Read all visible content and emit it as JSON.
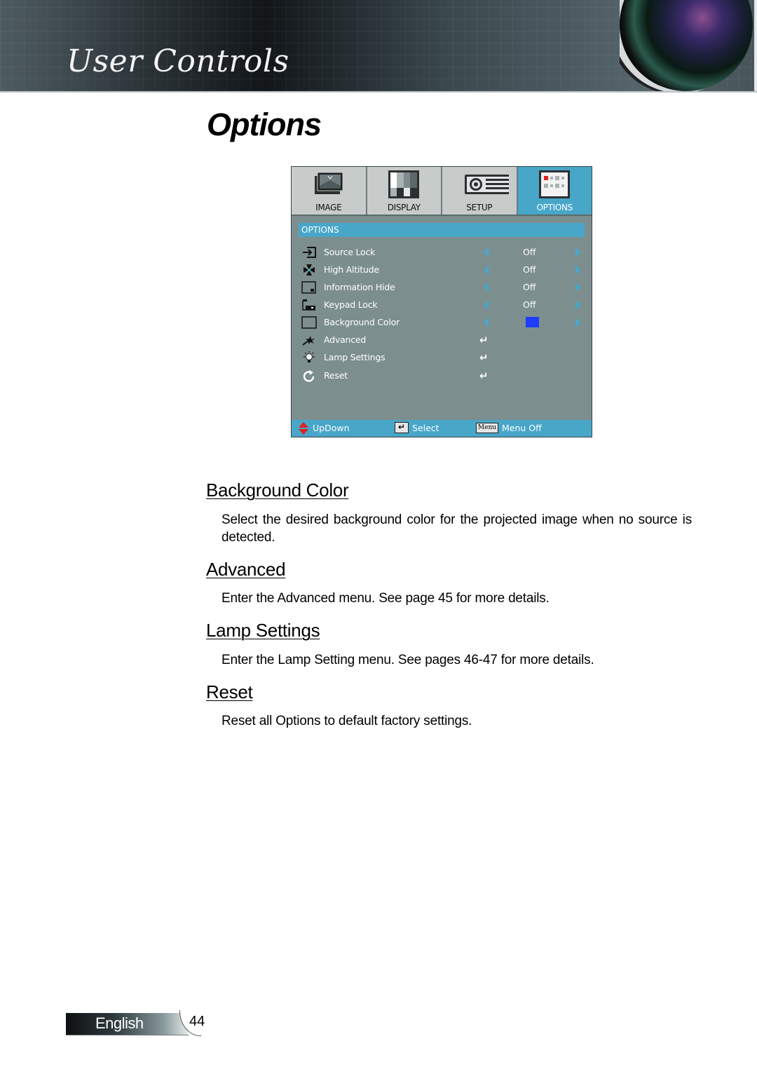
{
  "header": {
    "section_title": "User Controls",
    "page_title": "Options"
  },
  "osd": {
    "tabs": [
      {
        "label": "IMAGE",
        "icon": "image-icon",
        "active": false
      },
      {
        "label": "DISPLAY",
        "icon": "display-icon",
        "active": false
      },
      {
        "label": "SETUP",
        "icon": "projector-icon",
        "active": false
      },
      {
        "label": "OPTIONS",
        "icon": "options-icon",
        "active": true
      }
    ],
    "section_label": "OPTIONS",
    "rows": [
      {
        "label": "Source Lock",
        "icon": "source-lock-icon",
        "type": "toggle",
        "value": "Off"
      },
      {
        "label": "High Altitude",
        "icon": "fan-icon",
        "type": "toggle",
        "value": "Off"
      },
      {
        "label": "Information Hide",
        "icon": "info-hide-icon",
        "type": "toggle",
        "value": "Off"
      },
      {
        "label": "Keypad Lock",
        "icon": "keypad-lock-icon",
        "type": "toggle",
        "value": "Off"
      },
      {
        "label": "Background Color",
        "icon": "background-color-icon",
        "type": "color",
        "value": "#1f3cff"
      },
      {
        "label": "Advanced",
        "icon": "advanced-icon",
        "type": "enter",
        "value": "↵"
      },
      {
        "label": "Lamp Settings",
        "icon": "lamp-icon",
        "type": "enter",
        "value": "↵"
      },
      {
        "label": "Reset",
        "icon": "reset-icon",
        "type": "enter",
        "value": "↵"
      }
    ],
    "footer": {
      "updown": "UpDown",
      "select": "Select",
      "select_key": "↵",
      "menu_key": "Menu",
      "menu_off": "Menu Off"
    },
    "colors": {
      "accent": "#48a6c8",
      "panel": "#7d8e8f",
      "tab_inactive": "#c7ccca"
    }
  },
  "sections": [
    {
      "heading": "Background Color",
      "body": "Select the desired background color for the projected image when no source is detected."
    },
    {
      "heading": "Advanced",
      "body": "Enter the Advanced menu. See page 45 for more details."
    },
    {
      "heading": "Lamp Settings",
      "body": "Enter the Lamp Setting menu. See pages 46-47 for more details."
    },
    {
      "heading": "Reset",
      "body": "Reset all Options to default factory settings."
    }
  ],
  "footer": {
    "language": "English",
    "page_number": "44"
  }
}
